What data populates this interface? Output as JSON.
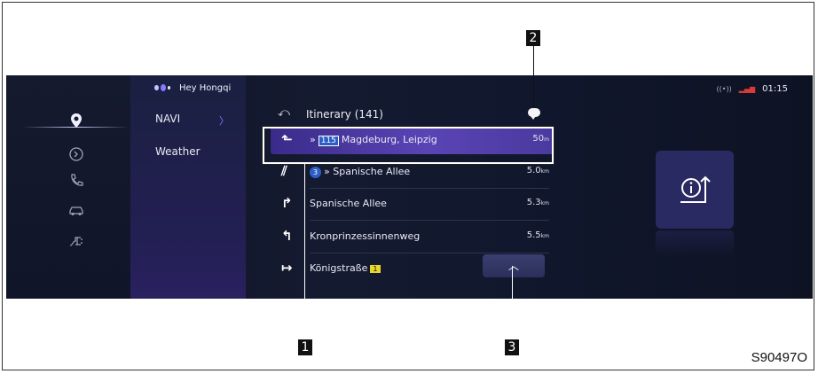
{
  "voice": {
    "label": "Hey Hongqi"
  },
  "status": {
    "signal_icon": "wifi-signal-icon",
    "network_icon": "cell-bars-icon",
    "time": "01:15"
  },
  "menu": {
    "items": [
      {
        "label": "NAVI"
      },
      {
        "label": "Weather"
      }
    ],
    "chevron": "〉"
  },
  "itinerary": {
    "back_symbol": "⤺",
    "title": "Itinerary (141)",
    "rows": [
      {
        "prefix": "»",
        "route": "115",
        "name": "Magdeburg, Leipzig",
        "dist": "50",
        "unit": "m"
      },
      {
        "circle": "3",
        "prefix": "»",
        "name": "Spanische Allee",
        "dist": "5.0",
        "unit": "km"
      },
      {
        "name": "Spanische Allee",
        "dist": "5.3",
        "unit": "km"
      },
      {
        "name": "Kronprinzessinnenweg",
        "dist": "5.5",
        "unit": "km"
      },
      {
        "name": "Königstraße",
        "badge": "1",
        "dist": "",
        "unit": ""
      }
    ]
  },
  "callouts": {
    "one": "1",
    "two": "2",
    "three": "3"
  },
  "code": "S90497O",
  "colors": {
    "accent": "#5a44b5",
    "highlight_border": "#ffffff"
  }
}
